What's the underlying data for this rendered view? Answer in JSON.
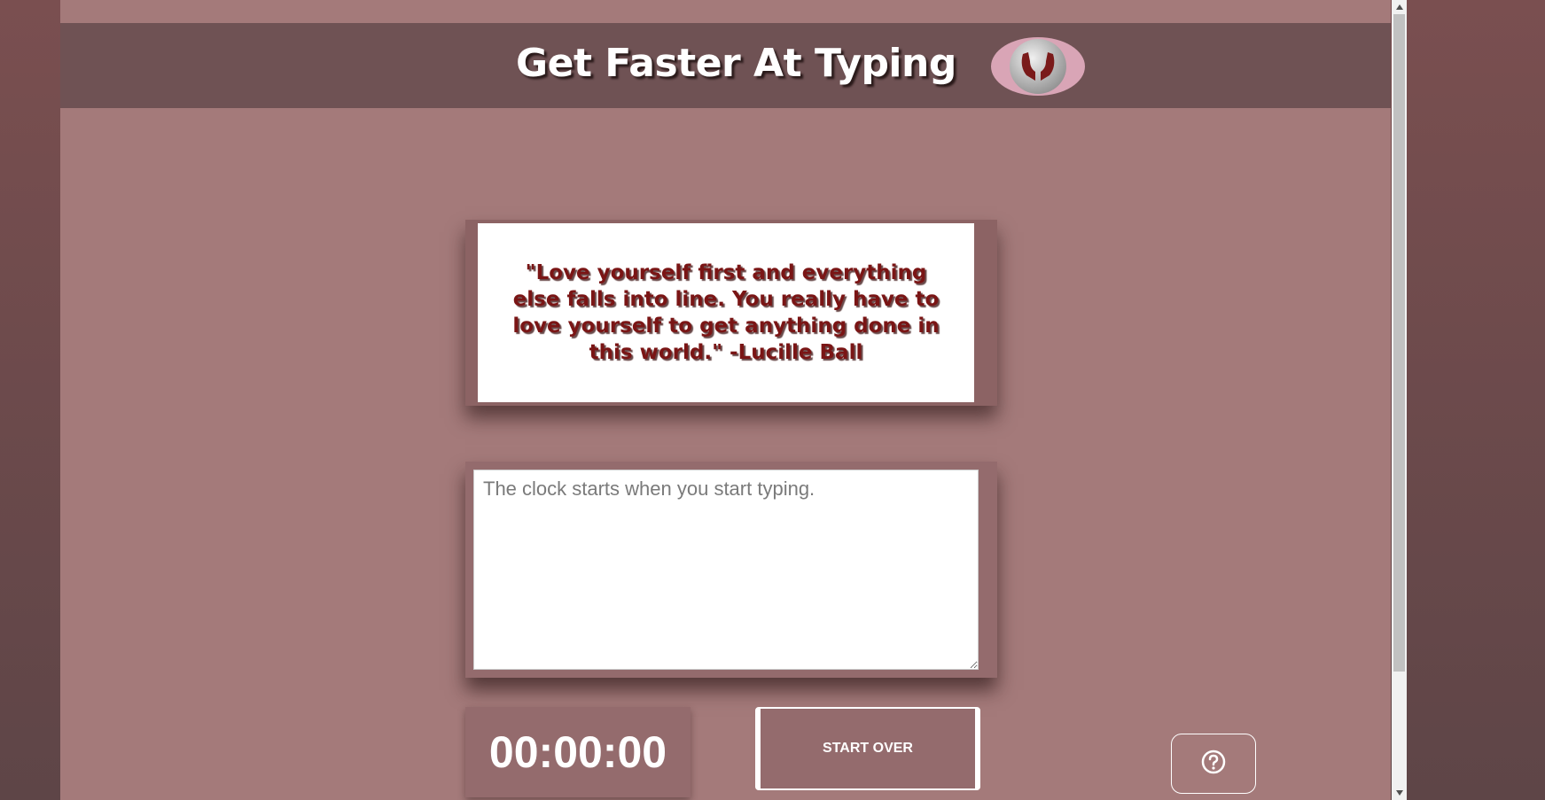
{
  "header": {
    "title": "Get Faster At Typing",
    "logo_icon": "hands-holding-sphere-icon"
  },
  "quote": {
    "text": "\"Love yourself first and everything else falls into line. You really have to love yourself to get anything done in this world.\" -Lucille Ball"
  },
  "typing": {
    "placeholder": "The clock starts when you start typing.",
    "value": ""
  },
  "timer": {
    "value": "00:00:00"
  },
  "controls": {
    "start_over_label": "START OVER",
    "help_icon": "question-circle-icon"
  },
  "colors": {
    "page_background": "#a47a7a",
    "header_background": "#6f5254",
    "quote_text": "#7a1515",
    "button_background": "#946b6d"
  }
}
